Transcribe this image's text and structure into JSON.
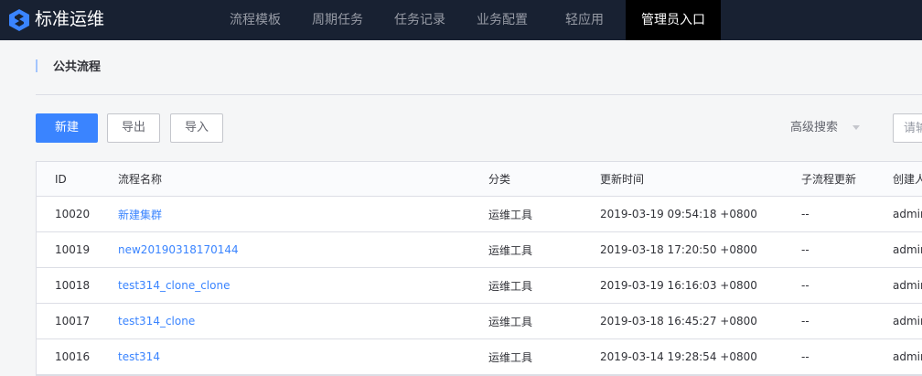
{
  "app": {
    "title": "标准运维"
  },
  "nav": {
    "items": [
      {
        "label": "流程模板",
        "active": false
      },
      {
        "label": "周期任务",
        "active": false
      },
      {
        "label": "任务记录",
        "active": false
      },
      {
        "label": "业务配置",
        "active": false
      },
      {
        "label": "轻应用",
        "active": false
      },
      {
        "label": "管理员入口",
        "active": true
      }
    ]
  },
  "page": {
    "title": "公共流程"
  },
  "toolbar": {
    "new_label": "新建",
    "export_label": "导出",
    "import_label": "导入",
    "advanced_search_label": "高级搜索",
    "search_placeholder": "请输入流程名称"
  },
  "table": {
    "columns": [
      "ID",
      "流程名称",
      "分类",
      "更新时间",
      "子流程更新",
      "创建人"
    ],
    "rows": [
      {
        "id": "10020",
        "name": "新建集群",
        "category": "运维工具",
        "updated": "2019-03-19 09:54:18 +0800",
        "subflow": "--",
        "creator": "admin"
      },
      {
        "id": "10019",
        "name": "new20190318170144",
        "category": "运维工具",
        "updated": "2019-03-18 17:20:50 +0800",
        "subflow": "--",
        "creator": "admin"
      },
      {
        "id": "10018",
        "name": "test314_clone_clone",
        "category": "运维工具",
        "updated": "2019-03-19 16:16:03 +0800",
        "subflow": "--",
        "creator": "admin"
      },
      {
        "id": "10017",
        "name": "test314_clone",
        "category": "运维工具",
        "updated": "2019-03-18 16:45:27 +0800",
        "subflow": "--",
        "creator": "admin"
      },
      {
        "id": "10016",
        "name": "test314",
        "category": "运维工具",
        "updated": "2019-03-14 19:28:54 +0800",
        "subflow": "--",
        "creator": "admin"
      }
    ]
  },
  "colors": {
    "topbar_bg": "#182132",
    "active_nav_bg": "#000000",
    "primary": "#3a84ff",
    "logo_blue": "#3a84ff"
  }
}
